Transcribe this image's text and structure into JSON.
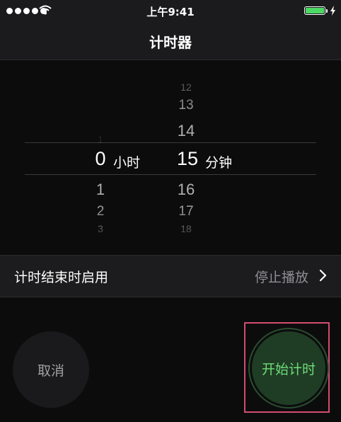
{
  "status_bar": {
    "time": "上午9:41"
  },
  "nav": {
    "title": "计时器"
  },
  "picker": {
    "hours": {
      "above": [
        "1"
      ],
      "selected": "0",
      "below": [
        "1",
        "2",
        "3"
      ],
      "unit": "小时"
    },
    "minutes": {
      "above": [
        "12",
        "13",
        "14"
      ],
      "selected": "15",
      "below": [
        "16",
        "17",
        "18"
      ],
      "unit": "分钟"
    }
  },
  "setting": {
    "label": "计时结束时启用",
    "value": "停止播放"
  },
  "buttons": {
    "cancel": "取消",
    "start": "开始计时"
  },
  "colors": {
    "accent": "#6fdc78",
    "start_bg": "#1f3d25",
    "battery": "#4cd964",
    "highlight": "#d34d6e"
  },
  "icons": [
    "cellular-signal-icon",
    "wifi-icon",
    "battery-icon",
    "charging-bolt-icon",
    "chevron-right-icon"
  ]
}
